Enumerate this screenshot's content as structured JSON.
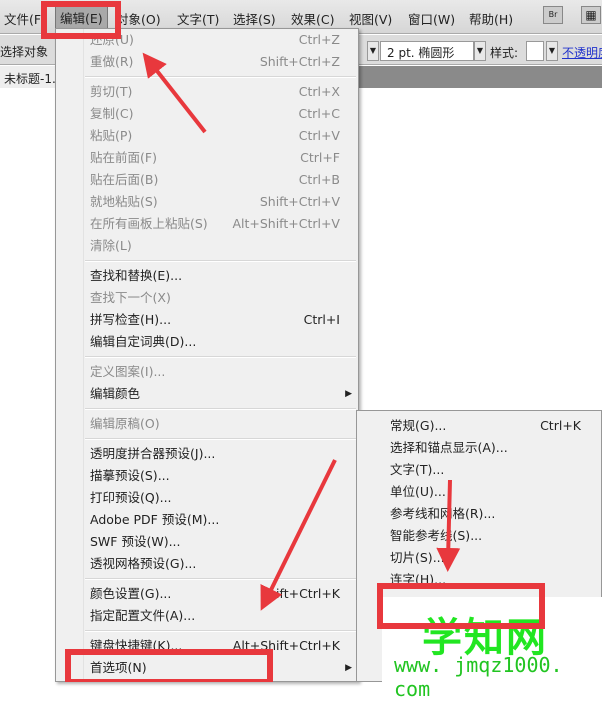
{
  "menubar": {
    "items": [
      "文件(F)",
      "编辑(E)",
      "对象(O)",
      "文字(T)",
      "选择(S)",
      "效果(C)",
      "视图(V)",
      "窗口(W)",
      "帮助(H)"
    ],
    "bridge": "Br"
  },
  "toolbar": {
    "left_label": "选择对象",
    "stroke": "2 pt. 椭圆形",
    "style_label": "样式:",
    "opacity_link": "不透明度"
  },
  "document_tab": "未标题-1.",
  "edit_menu": [
    [
      {
        "label": "还原(U)",
        "shortcut": "Ctrl+Z",
        "disabled": true
      },
      {
        "label": "重做(R)",
        "shortcut": "Shift+Ctrl+Z",
        "disabled": true
      }
    ],
    [
      {
        "label": "剪切(T)",
        "shortcut": "Ctrl+X",
        "disabled": true
      },
      {
        "label": "复制(C)",
        "shortcut": "Ctrl+C",
        "disabled": true
      },
      {
        "label": "粘贴(P)",
        "shortcut": "Ctrl+V",
        "disabled": true
      },
      {
        "label": "贴在前面(F)",
        "shortcut": "Ctrl+F",
        "disabled": true
      },
      {
        "label": "贴在后面(B)",
        "shortcut": "Ctrl+B",
        "disabled": true
      },
      {
        "label": "就地粘贴(S)",
        "shortcut": "Shift+Ctrl+V",
        "disabled": true
      },
      {
        "label": "在所有画板上粘贴(S)",
        "shortcut": "Alt+Shift+Ctrl+V",
        "disabled": true
      },
      {
        "label": "清除(L)",
        "shortcut": "",
        "disabled": true
      }
    ],
    [
      {
        "label": "查找和替换(E)...",
        "shortcut": ""
      },
      {
        "label": "查找下一个(X)",
        "shortcut": "",
        "disabled": true
      },
      {
        "label": "拼写检查(H)...",
        "shortcut": "Ctrl+I"
      },
      {
        "label": "编辑自定词典(D)...",
        "shortcut": ""
      }
    ],
    [
      {
        "label": "定义图案(I)...",
        "shortcut": "",
        "disabled": true
      },
      {
        "label": "编辑颜色",
        "shortcut": "",
        "submenu": true
      }
    ],
    [
      {
        "label": "编辑原稿(O)",
        "shortcut": "",
        "disabled": true
      }
    ],
    [
      {
        "label": "透明度拼合器预设(J)...",
        "shortcut": ""
      },
      {
        "label": "描摹预设(S)...",
        "shortcut": ""
      },
      {
        "label": "打印预设(Q)...",
        "shortcut": ""
      },
      {
        "label": "Adobe PDF 预设(M)...",
        "shortcut": ""
      },
      {
        "label": "SWF 预设(W)...",
        "shortcut": ""
      },
      {
        "label": "透视网格预设(G)...",
        "shortcut": ""
      }
    ],
    [
      {
        "label": "颜色设置(G)...",
        "shortcut": "Shift+Ctrl+K"
      },
      {
        "label": "指定配置文件(A)...",
        "shortcut": ""
      }
    ],
    [
      {
        "label": "键盘快捷键(K)...",
        "shortcut": "Alt+Shift+Ctrl+K"
      },
      {
        "label": "首选项(N)",
        "shortcut": "",
        "submenu": true
      }
    ]
  ],
  "preferences_submenu": [
    {
      "label": "常规(G)...",
      "shortcut": "Ctrl+K"
    },
    {
      "label": "选择和锚点显示(A)...",
      "shortcut": ""
    },
    {
      "label": "文字(T)...",
      "shortcut": ""
    },
    {
      "label": "单位(U)...",
      "shortcut": ""
    },
    {
      "label": "参考线和网格(R)...",
      "shortcut": ""
    },
    {
      "label": "智能参考线(S)...",
      "shortcut": ""
    },
    {
      "label": "切片(S)...",
      "shortcut": ""
    },
    {
      "label": "连字(H)...",
      "shortcut": ""
    }
  ],
  "watermark": {
    "title": "学知网",
    "url": "www. jmqz1000. com"
  },
  "colors": {
    "highlight_box": "#e8383d",
    "watermark": "#21e621"
  }
}
